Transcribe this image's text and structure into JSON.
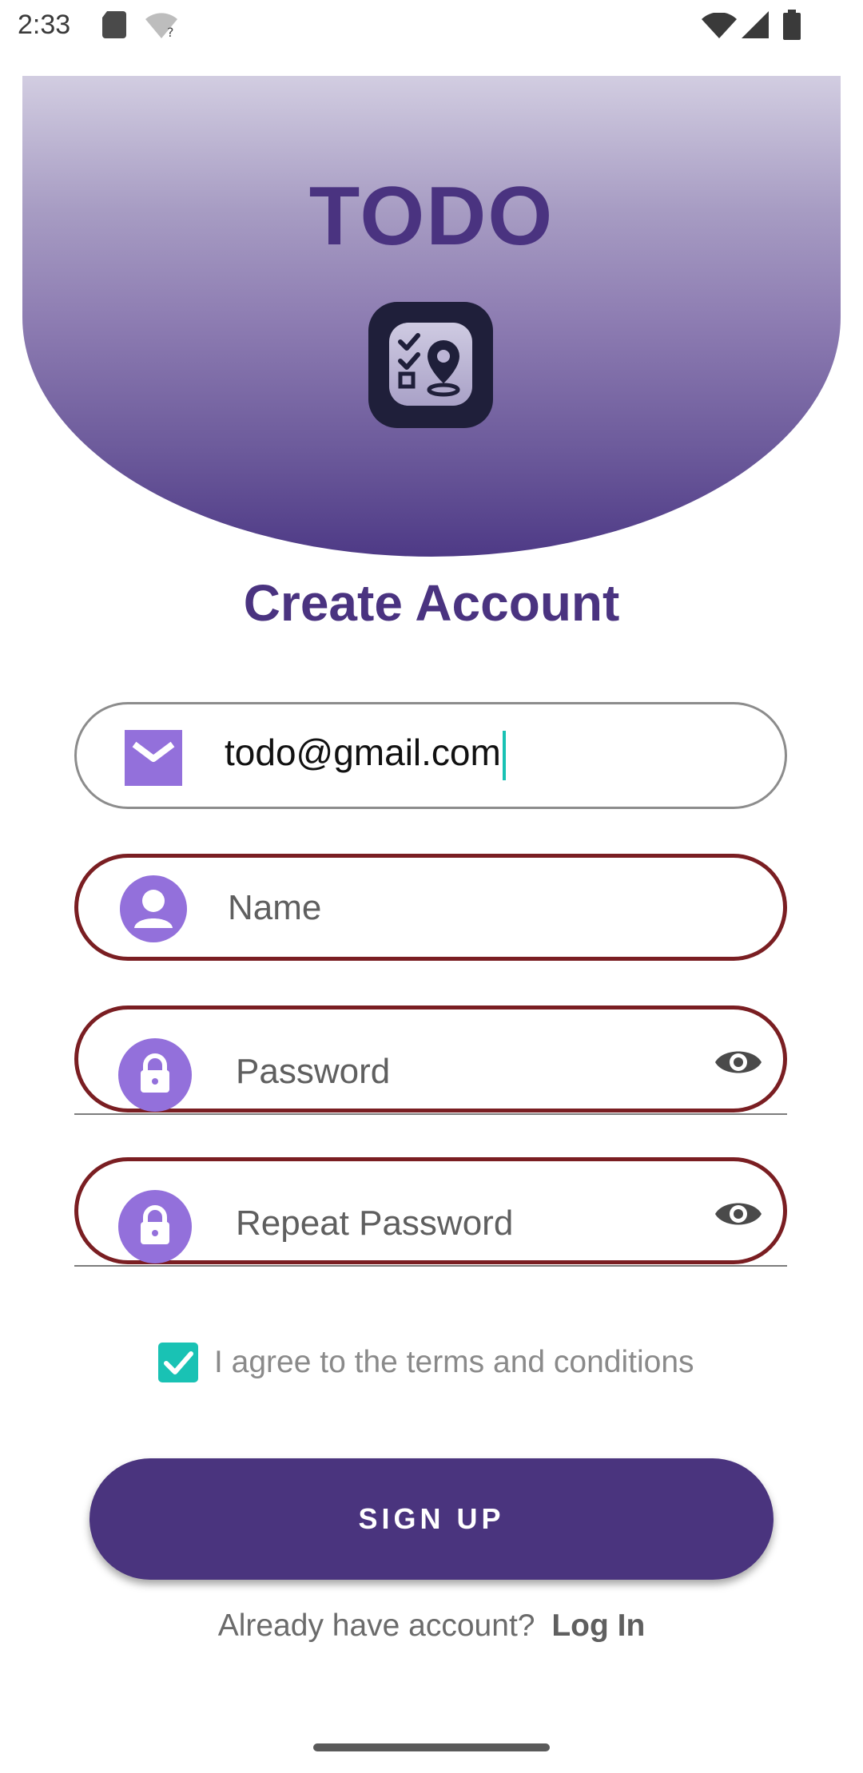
{
  "status_bar": {
    "time": "2:33"
  },
  "header": {
    "app_title": "TODO",
    "logo_icon": "checklist-location-icon"
  },
  "page": {
    "heading": "Create Account"
  },
  "form": {
    "email": {
      "value": "todo@gmail.com",
      "icon": "mail-icon"
    },
    "name": {
      "placeholder": "Name",
      "icon": "person-icon"
    },
    "password": {
      "placeholder": "Password",
      "icon": "lock-icon",
      "toggle_icon": "eye-icon"
    },
    "repeat_password": {
      "placeholder": "Repeat Password",
      "icon": "lock-icon",
      "toggle_icon": "eye-icon"
    },
    "terms": {
      "label": "I agree to the terms and conditions",
      "checked": true
    }
  },
  "actions": {
    "signup_label": "SIGN UP",
    "login_prompt": "Already have account?",
    "login_link": "Log In"
  },
  "colors": {
    "primary": "#4a347e",
    "icon_accent": "#9370db",
    "error_border": "#7a1e22",
    "checkbox": "#19c2b4"
  }
}
